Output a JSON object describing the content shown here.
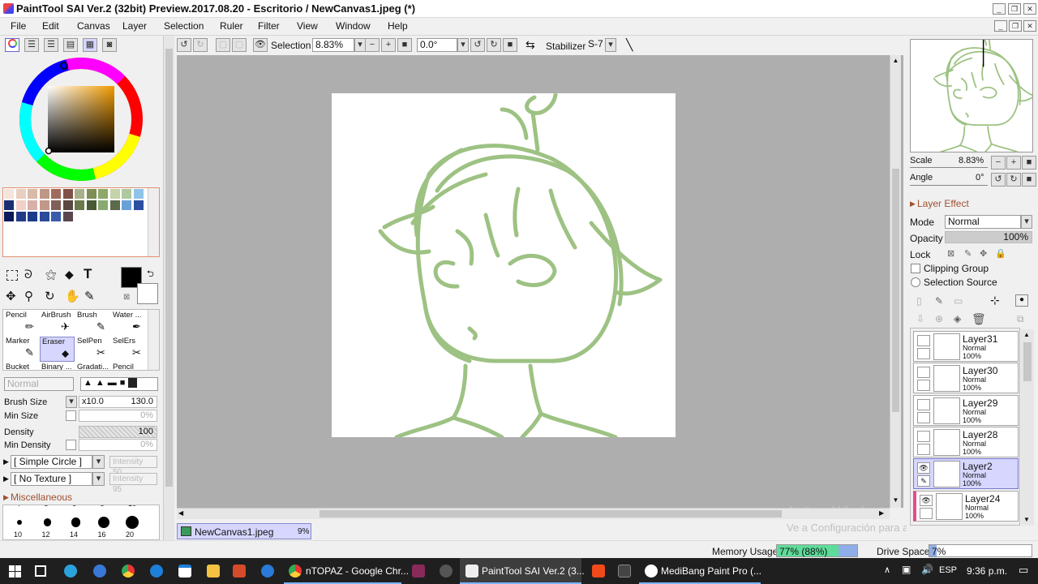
{
  "window": {
    "title": "PaintTool SAI Ver.2 (32bit) Preview.2017.08.20 - Escritorio / NewCanvas1.jpeg (*)"
  },
  "menu": [
    "File",
    "Edit",
    "Canvas",
    "Layer",
    "Selection",
    "Ruler",
    "Filter",
    "View",
    "Window",
    "Help"
  ],
  "toolbar": {
    "selection_label": "Selection",
    "zoom": "8.83%",
    "rotation": "0.0°",
    "stabilizer_label": "Stabilizer",
    "stabilizer_value": "S-7"
  },
  "colors": {
    "swatches": [
      "#f4e4da",
      "#e8cfc2",
      "#d9b9a8",
      "#bf9785",
      "#a06a5a",
      "#7f5148",
      "#a8b08a",
      "#7d8f55",
      "#8ea86a",
      "#c4d4a8",
      "#b0c8a0",
      "#8ec4e8",
      "#1a2e72",
      "#f0d0c8",
      "#d8b0a8",
      "#c09888",
      "#806058",
      "#5a4840",
      "#6a7a4a",
      "#4a5a34",
      "#88aa70",
      "#5a6a4a",
      "#6aa0d8",
      "#2a4ea0",
      "#0a1a5a",
      "#223a88",
      "#1a3a8a",
      "#2a4a9a",
      "#3a5aaa",
      "#5a4850"
    ],
    "primary": "#000000",
    "sketch": "#9dc283"
  },
  "tools": {
    "brushes": [
      {
        "name": "Pencil",
        "selected": false
      },
      {
        "name": "AirBrush",
        "selected": false
      },
      {
        "name": "Brush",
        "selected": false
      },
      {
        "name": "Water ...",
        "selected": false
      },
      {
        "name": "Marker",
        "selected": false
      },
      {
        "name": "Eraser",
        "selected": true
      },
      {
        "name": "SelPen",
        "selected": false
      },
      {
        "name": "SelErs",
        "selected": false
      },
      {
        "name": "Bucket",
        "selected": false
      },
      {
        "name": "Binary ...",
        "selected": false
      },
      {
        "name": "Gradati...",
        "selected": false
      },
      {
        "name": "Pencil",
        "selected": false
      }
    ]
  },
  "brush_settings": {
    "mode": "Normal",
    "size_label": "Brush Size",
    "size_mult": "x10.0",
    "size_value": "130.0",
    "min_size_label": "Min Size",
    "min_size_value": "0%",
    "density_label": "Density",
    "density_value": "100",
    "min_density_label": "Min Density",
    "min_density_value": "0%",
    "shape": "[ Simple Circle ]",
    "shape_intensity": "Intensity 50",
    "texture": "[ No Texture ]",
    "texture_intensity": "Intensity 95",
    "misc_label": "Miscellaneous",
    "dot_sizes": [
      "10",
      "12",
      "14",
      "16",
      "20"
    ],
    "dot_size_tops": [
      "4",
      "5",
      "6",
      "8",
      "10"
    ]
  },
  "document_tab": {
    "name": "NewCanvas1.jpeg",
    "zoom": "9%"
  },
  "navigator": {
    "scale_label": "Scale",
    "scale_value": "8.83%",
    "angle_label": "Angle",
    "angle_value": "0°"
  },
  "layer_panel": {
    "effect_label": "Layer Effect",
    "mode_label": "Mode",
    "mode_value": "Normal",
    "opacity_label": "Opacity",
    "opacity_value": "100%",
    "lock_label": "Lock",
    "clipping_label": "Clipping Group",
    "selection_source_label": "Selection Source",
    "layers": [
      {
        "name": "Layer31",
        "mode": "Normal",
        "opacity": "100%",
        "visible": false,
        "selected": false
      },
      {
        "name": "Layer30",
        "mode": "Normal",
        "opacity": "100%",
        "visible": false,
        "selected": false
      },
      {
        "name": "Layer29",
        "mode": "Normal",
        "opacity": "100%",
        "visible": false,
        "selected": false
      },
      {
        "name": "Layer28",
        "mode": "Normal",
        "opacity": "100%",
        "visible": false,
        "selected": false
      },
      {
        "name": "Layer2",
        "mode": "Normal",
        "opacity": "100%",
        "visible": true,
        "selected": true
      },
      {
        "name": "Layer24",
        "mode": "Normal",
        "opacity": "100%",
        "visible": true,
        "selected": false
      }
    ]
  },
  "status": {
    "memory_label": "Memory Usage",
    "memory_value": "77% (88%)",
    "memory_fraction": 0.77,
    "drive_label": "Drive Space",
    "drive_value": "7%",
    "drive_fraction": 0.07
  },
  "watermark": {
    "line1": "Activar Windows",
    "line2": "Ve a Configuración para activar Windows."
  },
  "taskbar": {
    "items": [
      "nTOPAZ - Google Chr...",
      "PaintTool SAI Ver.2 (3...",
      "MediBang Paint Pro (..."
    ],
    "lang": "ESP",
    "time": "9:36 p.m."
  }
}
